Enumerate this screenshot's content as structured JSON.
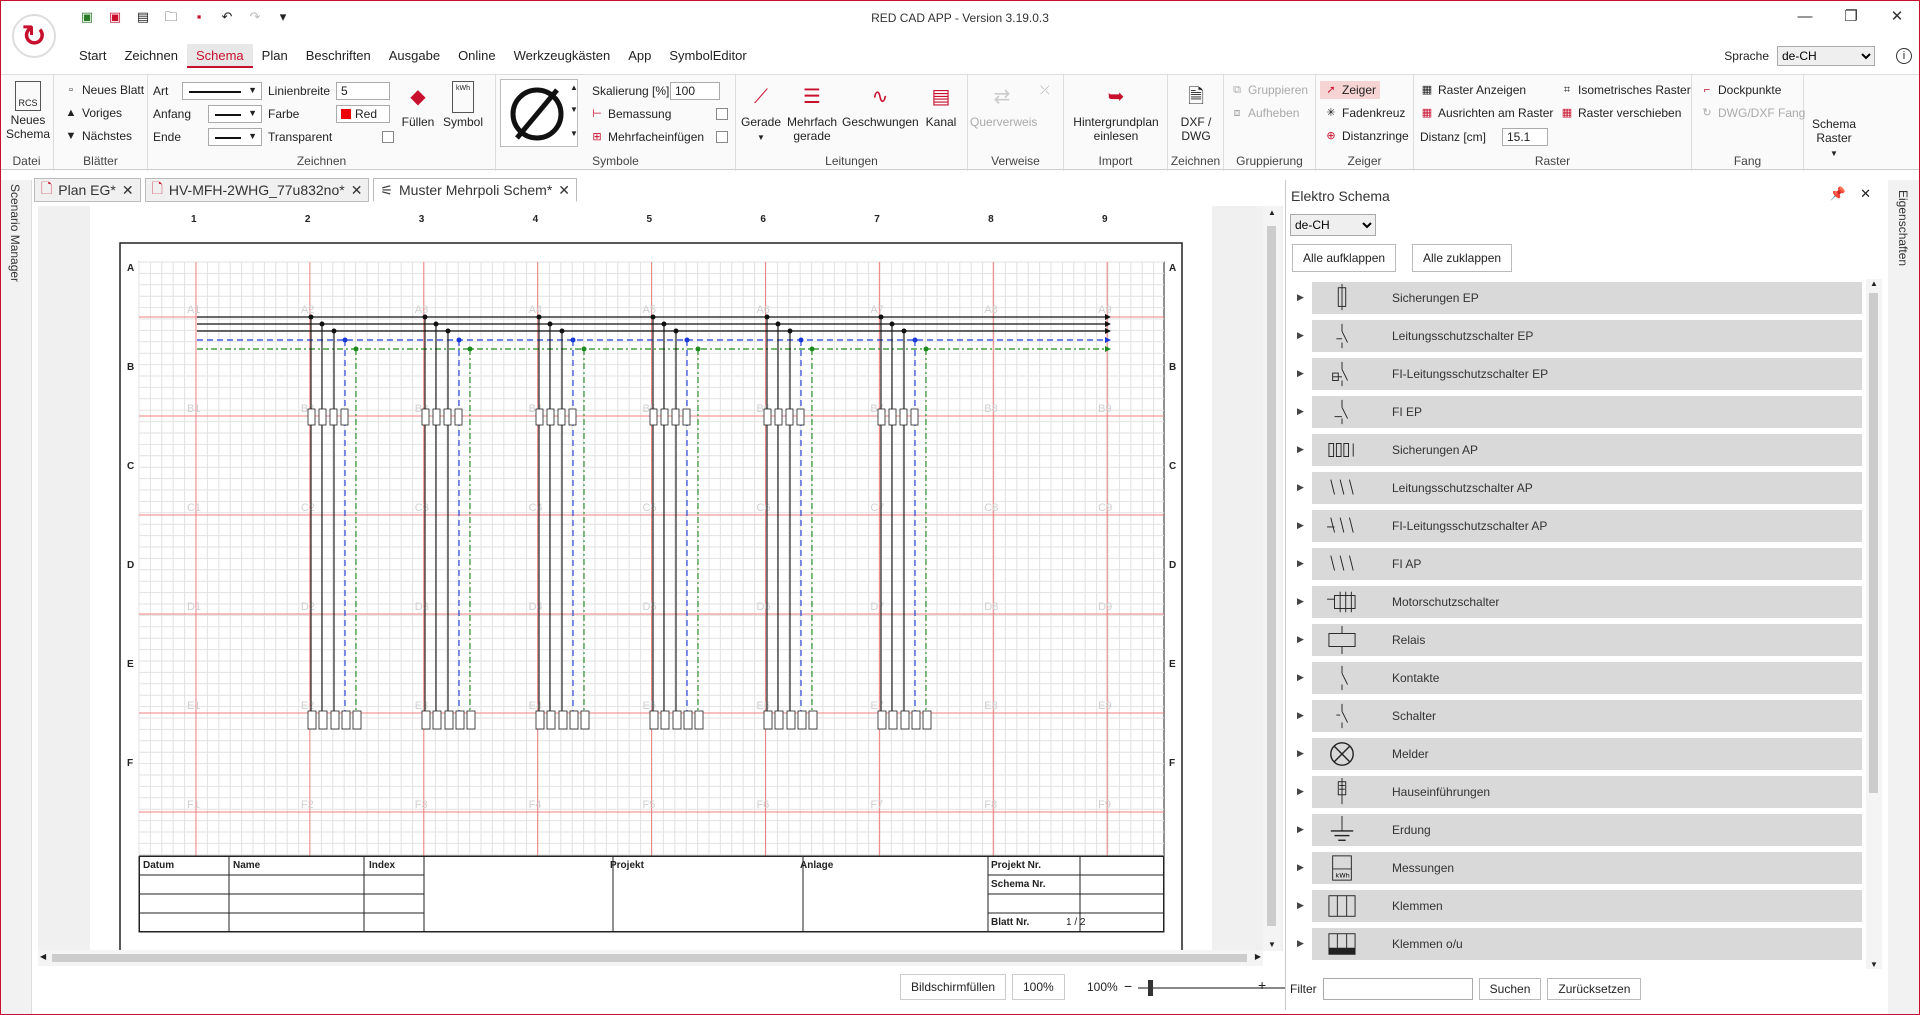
{
  "app": {
    "title": "RED CAD APP - Version 3.19.0.3"
  },
  "menu": [
    "Start",
    "Zeichnen",
    "Schema",
    "Plan",
    "Beschriften",
    "Ausgabe",
    "Online",
    "Werkzeugkästen",
    "App",
    "SymbolEditor"
  ],
  "sprache": {
    "label": "Sprache",
    "value": "de-CH"
  },
  "ribbon": {
    "datei": {
      "caption": "Datei",
      "neues_schema": "Neues Schema"
    },
    "blaetter": {
      "caption": "Blätter",
      "neues_blatt": "Neues Blatt",
      "voriges": "Voriges",
      "naechstes": "Nächstes"
    },
    "zeichnen": {
      "caption": "Zeichnen",
      "art": "Art",
      "anfang": "Anfang",
      "ende": "Ende",
      "linienbreite": "Linienbreite",
      "linienbreite_value": "5",
      "farbe": "Farbe",
      "farbe_value": "Red",
      "transparent": "Transparent",
      "fuellen": "Füllen",
      "symbol": "Symbol",
      "kwh": "kWh"
    },
    "symbole": {
      "caption": "Symbole",
      "skalierung": "Skalierung [%]",
      "skalierung_value": "100",
      "bemassung": "Bemassung",
      "mehrfacheinfuegen": "Mehrfacheinfügen"
    },
    "leitungen": {
      "caption": "Leitungen",
      "gerade": "Gerade",
      "mehrfach": "Mehrfach gerade",
      "geschwungen": "Geschwungen",
      "kanal": "Kanal"
    },
    "verweise": {
      "caption": "Verweise",
      "querverweis": "Querverweis"
    },
    "import": {
      "caption": "Import",
      "hintergrund": "Hintergrundplan einlesen"
    },
    "zeichnen2": {
      "caption": "Zeichnen",
      "dxf": "DXF / DWG"
    },
    "gruppierung": {
      "caption": "Gruppierung",
      "gruppieren": "Gruppieren",
      "aufheben": "Aufheben"
    },
    "zeiger": {
      "caption": "Zeiger",
      "zeiger": "Zeiger",
      "fadenkreuz": "Fadenkreuz",
      "distanzringe": "Distanzringe"
    },
    "raster": {
      "caption": "Raster",
      "anzeigen": "Raster Anzeigen",
      "ausrichten": "Ausrichten am Raster",
      "distanz": "Distanz [cm]",
      "distanz_value": "15.1",
      "isometrisch": "Isometrisches Raster",
      "verschieben": "Raster verschieben"
    },
    "fang": {
      "caption": "Fang",
      "dockpunkte": "Dockpunkte",
      "dwg_fang": "DWG/DXF Fang"
    },
    "schema_raster": "Schema Raster"
  },
  "doc_tabs": [
    "Plan EG*",
    "HV-MFH-2WHG_77u832no*",
    "Muster Mehrpoli Schem*"
  ],
  "left_sidebar": "Scenario Manager",
  "right_sidebar": "Eigenschaften",
  "schematic": {
    "columns": [
      "1",
      "2",
      "3",
      "4",
      "5",
      "6",
      "7",
      "8",
      "9"
    ],
    "rows": [
      "A",
      "B",
      "C",
      "D",
      "E",
      "F"
    ],
    "cells_prefix_rows": [
      "A",
      "B",
      "C",
      "D",
      "E",
      "F"
    ],
    "title_block": {
      "datum": "Datum",
      "name": "Name",
      "index": "Index",
      "projekt": "Projekt",
      "anlage": "Anlage",
      "projekt_nr": "Projekt Nr.",
      "schema_nr": "Schema Nr.",
      "blatt_nr": "Blatt Nr.",
      "blatt_value": "1 / 2"
    }
  },
  "statusbar": {
    "bildschirm": "Bildschirmfüllen",
    "zoom_btn": "100%",
    "zoom_label": "100%"
  },
  "panel": {
    "title": "Elektro Schema",
    "lang": "de-CH",
    "expand_all": "Alle aufklappen",
    "collapse_all": "Alle zuklappen",
    "items": [
      {
        "label": "Sicherungen EP",
        "icon": "fuse-icon"
      },
      {
        "label": "Leitungsschutzschalter EP",
        "icon": "breaker-icon"
      },
      {
        "label": "FI-Leitungsschutzschalter EP",
        "icon": "rcbo-icon"
      },
      {
        "label": "FI EP",
        "icon": "rcd-icon"
      },
      {
        "label": "Sicherungen AP",
        "icon": "fuse-multi-icon"
      },
      {
        "label": "Leitungsschutzschalter AP",
        "icon": "breaker-multi-icon"
      },
      {
        "label": "FI-Leitungsschutzschalter AP",
        "icon": "rcbo-multi-icon"
      },
      {
        "label": "FI AP",
        "icon": "rcd-multi-icon"
      },
      {
        "label": "Motorschutzschalter",
        "icon": "motor-protection-icon"
      },
      {
        "label": "Relais",
        "icon": "relay-icon"
      },
      {
        "label": "Kontakte",
        "icon": "contact-icon"
      },
      {
        "label": "Schalter",
        "icon": "switch-icon"
      },
      {
        "label": "Melder",
        "icon": "indicator-lamp-icon"
      },
      {
        "label": "Hauseinführungen",
        "icon": "house-entry-icon"
      },
      {
        "label": "Erdung",
        "icon": "ground-icon"
      },
      {
        "label": "Messungen",
        "icon": "meter-icon"
      },
      {
        "label": "Klemmen",
        "icon": "terminal-icon"
      },
      {
        "label": "Klemmen o/u",
        "icon": "terminal-ou-icon"
      }
    ],
    "filter_label": "Filter",
    "suchen": "Suchen",
    "zuruecksetzen": "Zurücksetzen"
  }
}
